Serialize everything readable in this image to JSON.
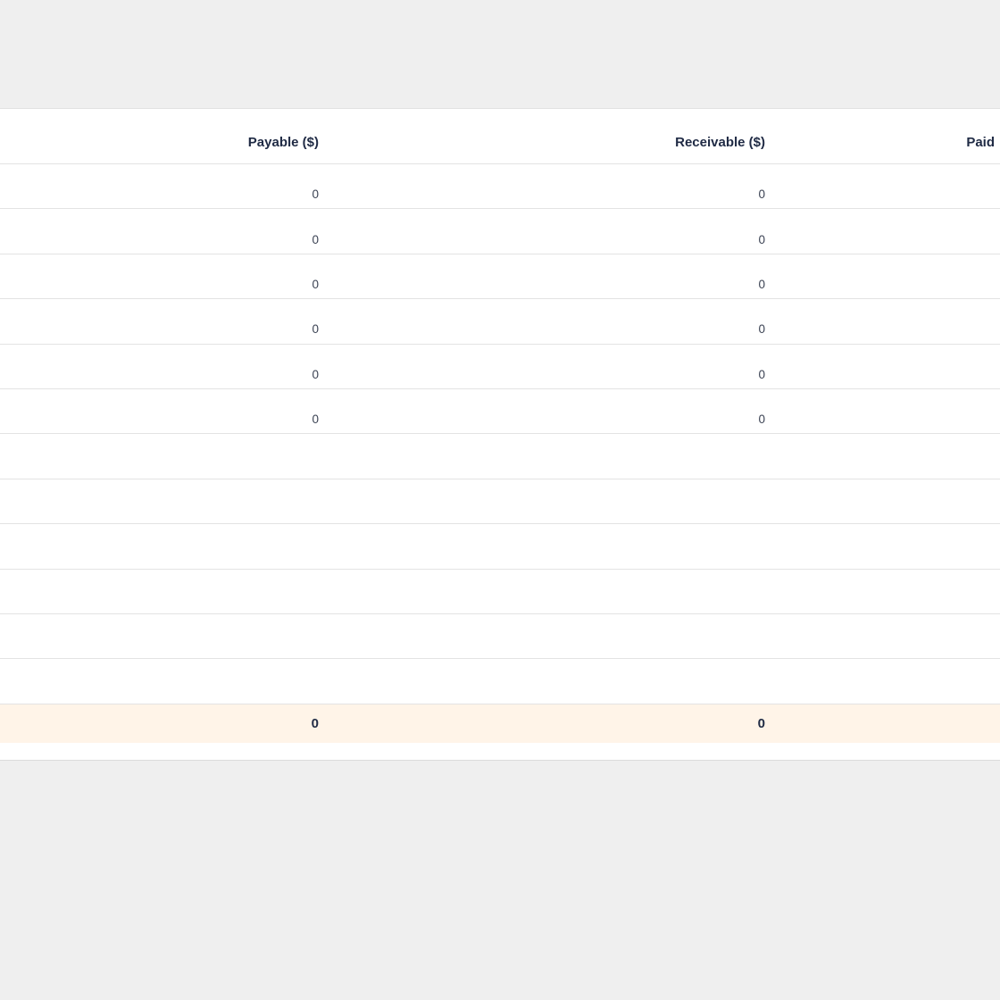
{
  "table": {
    "columns": [
      {
        "key": "payable",
        "label": "Payable ($)"
      },
      {
        "key": "receivable",
        "label": "Receivable ($)"
      },
      {
        "key": "paid",
        "label": "Paid"
      }
    ],
    "rows": [
      {
        "payable": "0",
        "receivable": "0",
        "paid": ""
      },
      {
        "payable": "0",
        "receivable": "0",
        "paid": ""
      },
      {
        "payable": "0",
        "receivable": "0",
        "paid": ""
      },
      {
        "payable": "0",
        "receivable": "0",
        "paid": ""
      },
      {
        "payable": "0",
        "receivable": "0",
        "paid": ""
      },
      {
        "payable": "0",
        "receivable": "0",
        "paid": ""
      },
      {
        "payable": "",
        "receivable": "",
        "paid": ""
      },
      {
        "payable": "",
        "receivable": "",
        "paid": ""
      },
      {
        "payable": "",
        "receivable": "",
        "paid": ""
      },
      {
        "payable": "",
        "receivable": "",
        "paid": ""
      },
      {
        "payable": "",
        "receivable": "",
        "paid": ""
      },
      {
        "payable": "",
        "receivable": "",
        "paid": ""
      }
    ],
    "totals": {
      "payable": "0",
      "receivable": "0",
      "paid": ""
    }
  },
  "colors": {
    "page_background": "#efefef",
    "panel_background": "#ffffff",
    "totals_background": "#fff4e8",
    "header_text": "#1f2a44",
    "cell_text": "#3b4253",
    "row_border": "#e3e3e3"
  }
}
